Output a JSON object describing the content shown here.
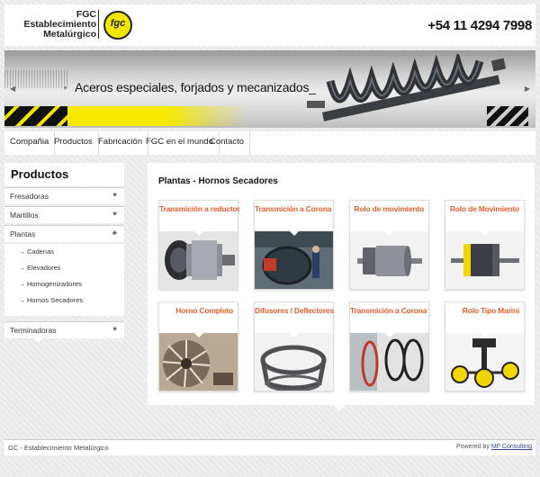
{
  "header": {
    "logo_line1": "FGC",
    "logo_line2": "Establecimiento",
    "logo_line3": "Metalúrgico",
    "logo_mark_text": "fgc",
    "phone": "+54 11 4294 7998"
  },
  "banner": {
    "slogan": "Aceros especiales, forjados y mecanizados_",
    "arrow": "›"
  },
  "nav": {
    "items": [
      "Compañia",
      "Productos",
      "Fabricación",
      "FGC en el mundo",
      "Contacto"
    ]
  },
  "sidebar": {
    "title": "Productos",
    "items": [
      {
        "label": "Fresadoras",
        "icon": "heart-chevron-icon"
      },
      {
        "label": "Martillos",
        "icon": "heart-chevron-icon"
      },
      {
        "label": "Plantas",
        "icon": "club-chevron-icon"
      }
    ],
    "subitems": [
      "Cadenas",
      "Elevadores",
      "Homogenizadores",
      "Hornos Secadores"
    ],
    "bottom_item": "Terminadoras"
  },
  "content": {
    "section_title": "Plantas - Hornos Secadores",
    "cards": [
      {
        "label": "Transmición a reductor"
      },
      {
        "label": "Transmición a Corona"
      },
      {
        "label": "Rolo de movimiento"
      },
      {
        "label": "Rolo de Movimiento"
      },
      {
        "label": "Horno Completo"
      },
      {
        "label": "Difusores / Deflectores"
      },
      {
        "label": "Transmición a Corona"
      },
      {
        "label": "Rolo Tipo Marini"
      }
    ]
  },
  "footer": {
    "left": "GC - Establecimiento Metalúrgico",
    "powered_prefix": "Powered by",
    "powered_link": "MF Consulting"
  },
  "colors": {
    "accent_orange": "#e0602a",
    "brand_yellow": "#f2e600"
  }
}
